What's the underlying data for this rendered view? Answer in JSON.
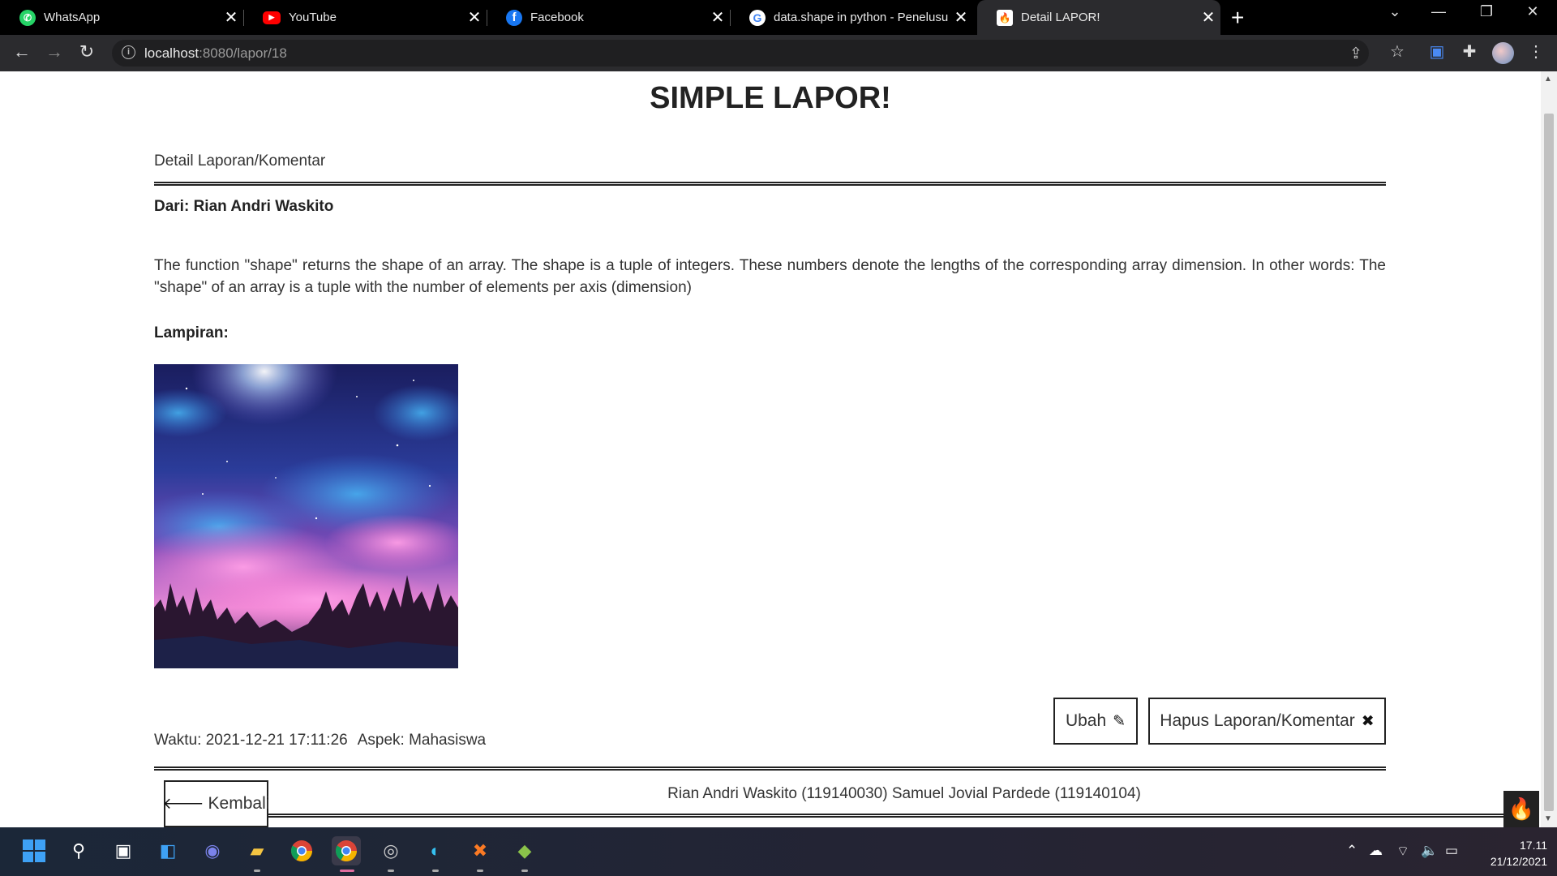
{
  "browser": {
    "tabs": [
      {
        "title": "WhatsApp",
        "icon": "whatsapp-icon",
        "color": "#25d366",
        "glyph": "✆",
        "active": false
      },
      {
        "title": "YouTube",
        "icon": "youtube-icon",
        "color": "#ff0000",
        "glyph": "▶",
        "active": false
      },
      {
        "title": "Facebook",
        "icon": "facebook-icon",
        "color": "#1877f2",
        "glyph": "f",
        "active": false
      },
      {
        "title": "data.shape in python - Penelusur",
        "icon": "google-icon",
        "color": "#ffffff",
        "glyph": "G",
        "active": false
      },
      {
        "title": "Detail LAPOR!",
        "icon": "flame-icon",
        "color": "#ffffff",
        "glyph": "🔥",
        "active": true
      }
    ],
    "url_host": "localhost",
    "url_rest": ":8080/lapor/18"
  },
  "page": {
    "site_title": "SIMPLE LAPOR!",
    "section_label": "Detail Laporan/Komentar",
    "author": "Dari: Rian Andri Waskito",
    "report_text": "The function \"shape\" returns the shape of an array. The shape is a tuple of integers. These numbers denote the lengths of the corresponding array dimension. In other words: The \"shape\" of an array is a tuple with the number of elements per axis (dimension)",
    "attachment_label": "Lampiran:",
    "timestamp": "Waktu: 2021-12-21 17:11:26",
    "aspect": "Aspek: Mahasiswa",
    "edit_label": "Ubah",
    "delete_label": "Hapus Laporan/Komentar",
    "back_label": "Kembali",
    "credits": "Rian Andri Waskito (119140030) Samuel Jovial Pardede (119140104)"
  },
  "taskbar": {
    "time": "17.11",
    "date": "21/12/2021"
  }
}
